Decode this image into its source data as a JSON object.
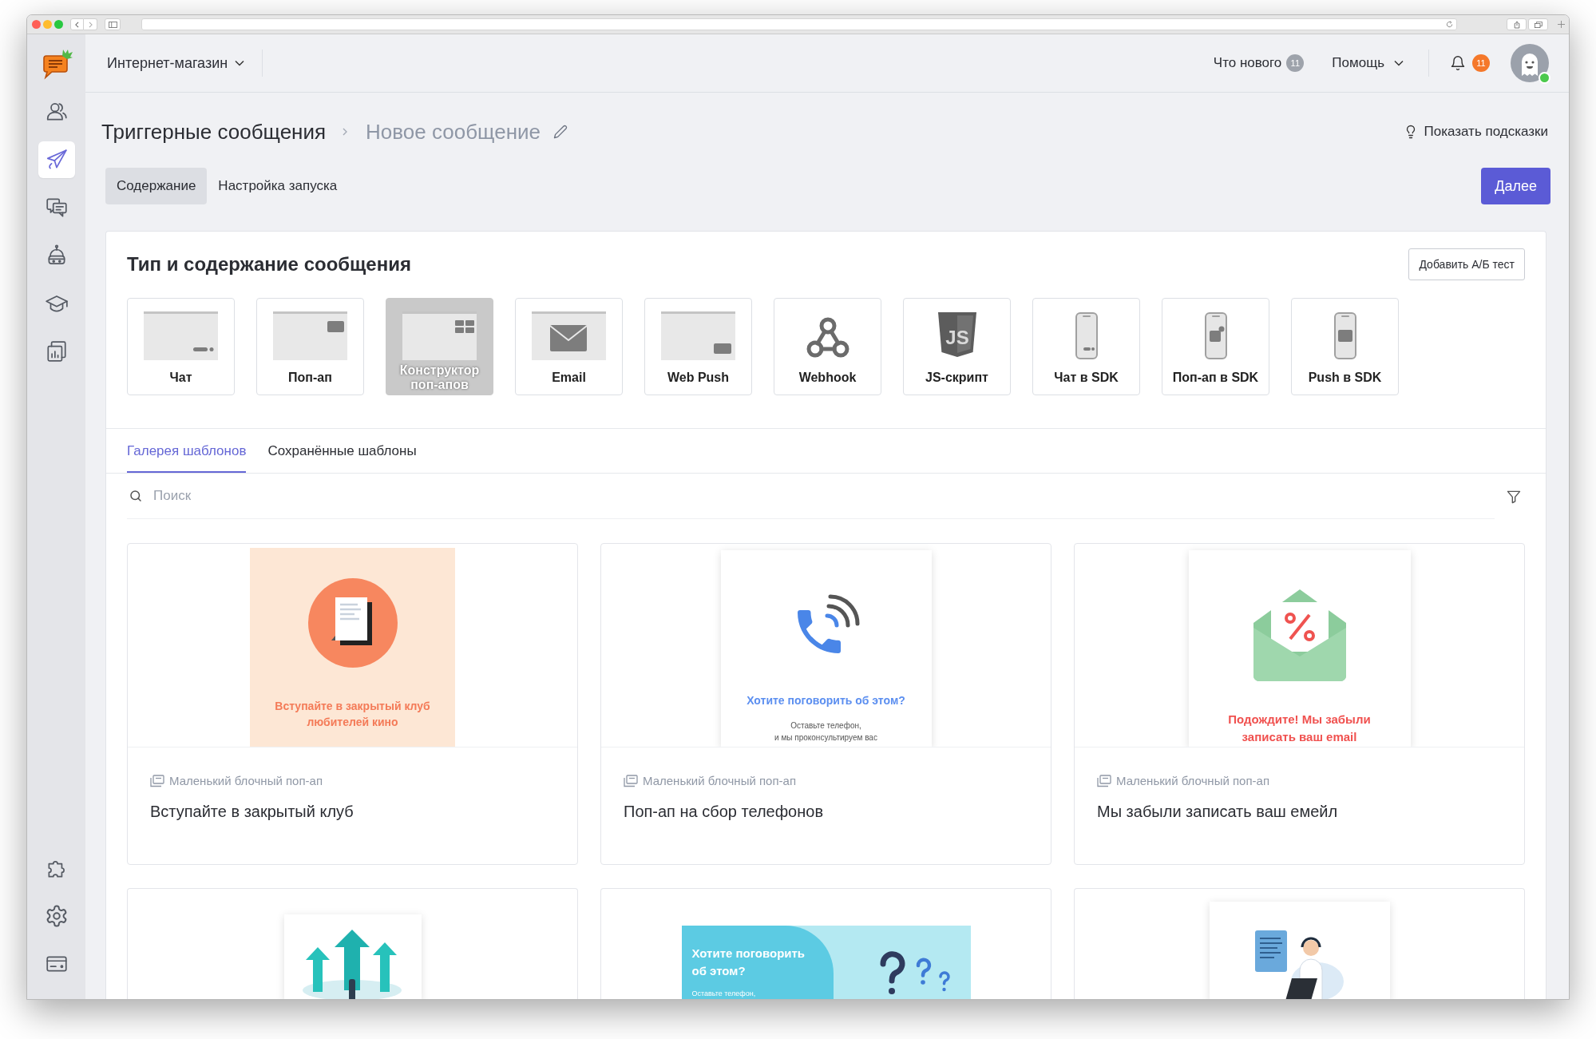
{
  "header": {
    "workspace": "Интернет-магазин",
    "whats_new": {
      "label": "Что нового",
      "count": "11"
    },
    "help": "Помощь",
    "notifications": {
      "count": "11"
    },
    "avatar": {
      "online": true
    }
  },
  "sidebar": {
    "top_items": [
      {
        "selected": false
      },
      {
        "selected": true
      },
      {
        "selected": false
      },
      {
        "selected": false
      },
      {
        "selected": false
      },
      {
        "selected": false
      }
    ],
    "bottom_items": [
      {
        "selected": false
      },
      {
        "selected": false
      },
      {
        "selected": false
      }
    ]
  },
  "breadcrumb": [
    {
      "label": "Триггерные сообщения",
      "current": false
    },
    {
      "label": "Новое сообщение",
      "current": true
    }
  ],
  "hints_link": "Показать подсказки",
  "tabs": [
    {
      "label": "Содержание",
      "selected": true
    },
    {
      "label": "Настройка запуска",
      "selected": false
    }
  ],
  "next_button": "Далее",
  "message_type": {
    "title": "Тип и содержание сообщения",
    "ab_test_button": "Добавить А/Б тест",
    "types": [
      {
        "label": "Чат",
        "disabled": false
      },
      {
        "label": "Поп-ап",
        "disabled": false
      },
      {
        "label": "Конструктор поп-апов",
        "disabled": true
      },
      {
        "label": "Email",
        "disabled": false
      },
      {
        "label": "Web Push",
        "disabled": false
      },
      {
        "label": "Webhook",
        "disabled": false
      },
      {
        "label": "JS-скрипт",
        "logo_text": "JS",
        "disabled": false
      },
      {
        "label": "Чат в SDK",
        "disabled": false
      },
      {
        "label": "Поп-ап в SDK",
        "disabled": false
      },
      {
        "label": "Push в SDK",
        "disabled": false
      }
    ]
  },
  "gallery": {
    "tabs": [
      {
        "label": "Галерея шаблонов",
        "selected": true
      },
      {
        "label": "Сохранённые шаблоны",
        "selected": false
      }
    ],
    "search": {
      "placeholder": "Поиск"
    },
    "templates": [
      {
        "category": "Маленький блочный поп-ап",
        "title": "Вступайте в закрытый клуб",
        "preview": {
          "kind": "club",
          "heading": "Вступайте в закрытый клуб\nлюбителей кино"
        }
      },
      {
        "category": "Маленький блочный поп-ап",
        "title": "Поп-ап на сбор телефонов",
        "preview": {
          "kind": "phone",
          "heading": "Хотите поговорить об этом?",
          "text": "Оставьте телефон,\nи мы проконсультируем вас"
        }
      },
      {
        "category": "Маленький блочный поп-ап",
        "title": "Мы забыли записать ваш емейл",
        "preview": {
          "kind": "email",
          "heading": "Подождите! Мы забыли\nзаписать ваш email"
        }
      },
      {
        "preview": {
          "kind": "growth"
        }
      },
      {
        "preview": {
          "kind": "question",
          "heading": "Хотите поговорить\nоб этом?",
          "text": "Оставьте телефон,"
        }
      },
      {
        "preview": {
          "kind": "support"
        }
      }
    ]
  }
}
